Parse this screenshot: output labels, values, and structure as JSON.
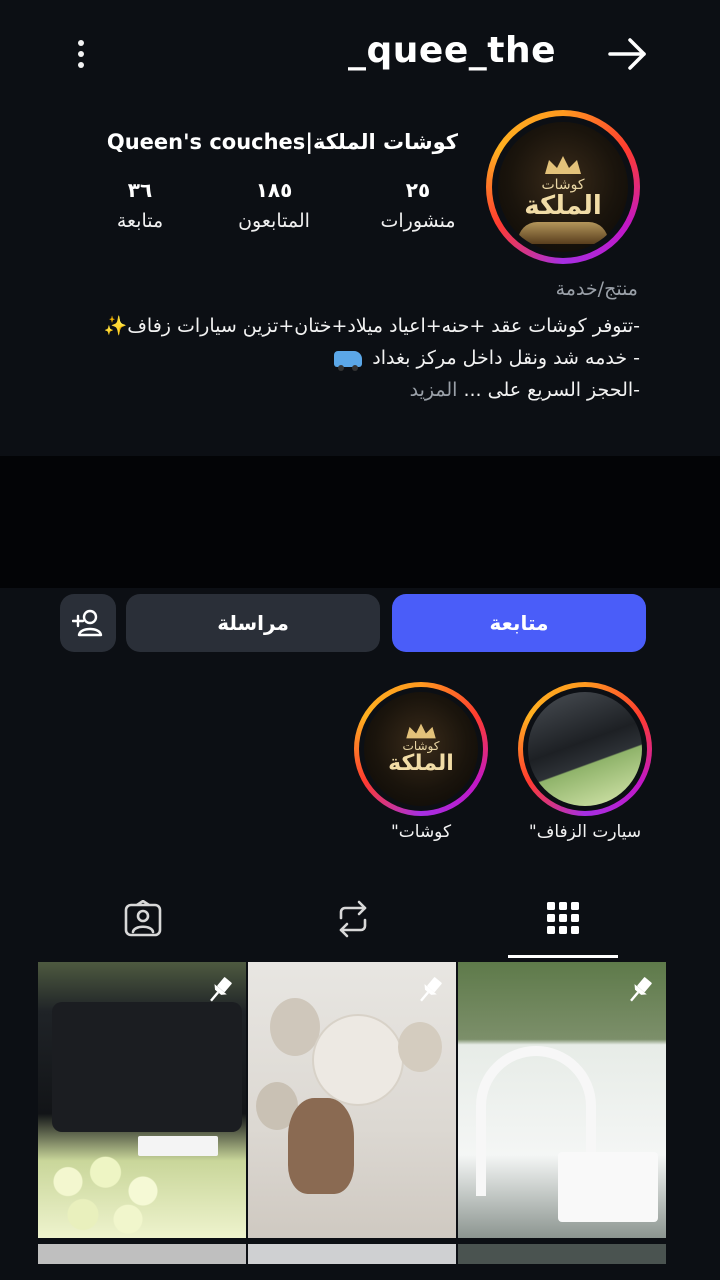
{
  "header": {
    "username": "_quee_the",
    "menu_icon": "more-vertical-icon",
    "back_icon": "arrow-right-icon"
  },
  "profile": {
    "display_name": "كوشات الملكة|Queen's couches",
    "avatar_logo_small": "كوشات",
    "avatar_logo_big": "الملكة",
    "stats": {
      "posts_count": "٢٥",
      "posts_label": "منشورات",
      "followers_count": "١٨٥",
      "followers_label": "المتابعون",
      "following_count": "٣٦",
      "following_label": "متابعة"
    },
    "category": "منتج/خدمة",
    "bio_line1": "-تتوفر كوشات عقد +حنه+اعياد ميلاد+ختان+تزين سيارات زفاف✨",
    "bio_line2": "- خدمه شد ونقل داخل مركز بغداد",
    "bio_line3": "-الحجز السريع على ...",
    "bio_more": "المزيد"
  },
  "actions": {
    "follow_label": "متابعة",
    "message_label": "مراسلة",
    "add_icon": "add-person-icon"
  },
  "highlights": [
    {
      "label": "سيارت الزفاف\""
    },
    {
      "label": "كوشات\""
    }
  ],
  "tabs": [
    {
      "icon": "grid-icon",
      "active": true
    },
    {
      "icon": "repost-icon",
      "active": false
    },
    {
      "icon": "tagged-person-icon",
      "active": false
    }
  ],
  "colors": {
    "background": "#0c0f14",
    "primary_button": "#4a5df9",
    "secondary_button": "#2a2f38",
    "muted_text": "#9aa0a8"
  }
}
